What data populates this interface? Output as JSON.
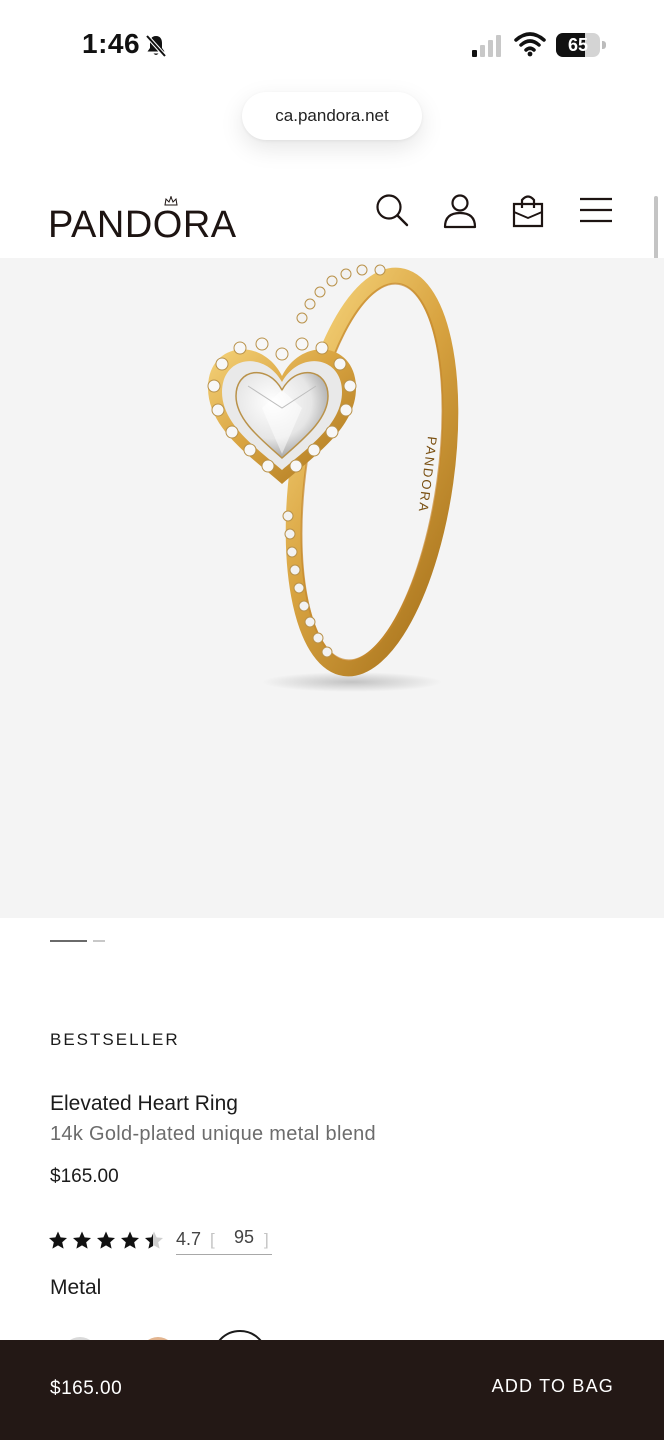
{
  "status_bar": {
    "time": "1:46",
    "battery_level": "65",
    "battery_fraction": 0.65,
    "icons": [
      "bell-slash-icon",
      "cellular-signal-icon",
      "wifi-icon",
      "battery-icon"
    ]
  },
  "browser": {
    "url": "ca.pandora.net"
  },
  "header": {
    "logo_text": "PANDORA",
    "icons": [
      "search-icon",
      "account-icon",
      "shopping-bag-icon",
      "menu-icon"
    ]
  },
  "carousel": {
    "slides": 2,
    "active_slide": 1
  },
  "product": {
    "badge": "BESTSELLER",
    "name": "Elevated Heart Ring",
    "material": "14k Gold-plated unique metal blend",
    "price": "$165.00",
    "rating": "4.7",
    "rating_value": 4.7,
    "review_count": "95",
    "metal_label": "Metal",
    "engraving": "PANDORA"
  },
  "sticky_bar": {
    "price": "$165.00",
    "add_to_bag_label": "ADD TO BAG"
  },
  "colors": {
    "brand_dark": "#231815",
    "image_bg": "#f4f4f4",
    "gold": "#d9a441",
    "text_secondary": "#6c6c6c"
  }
}
